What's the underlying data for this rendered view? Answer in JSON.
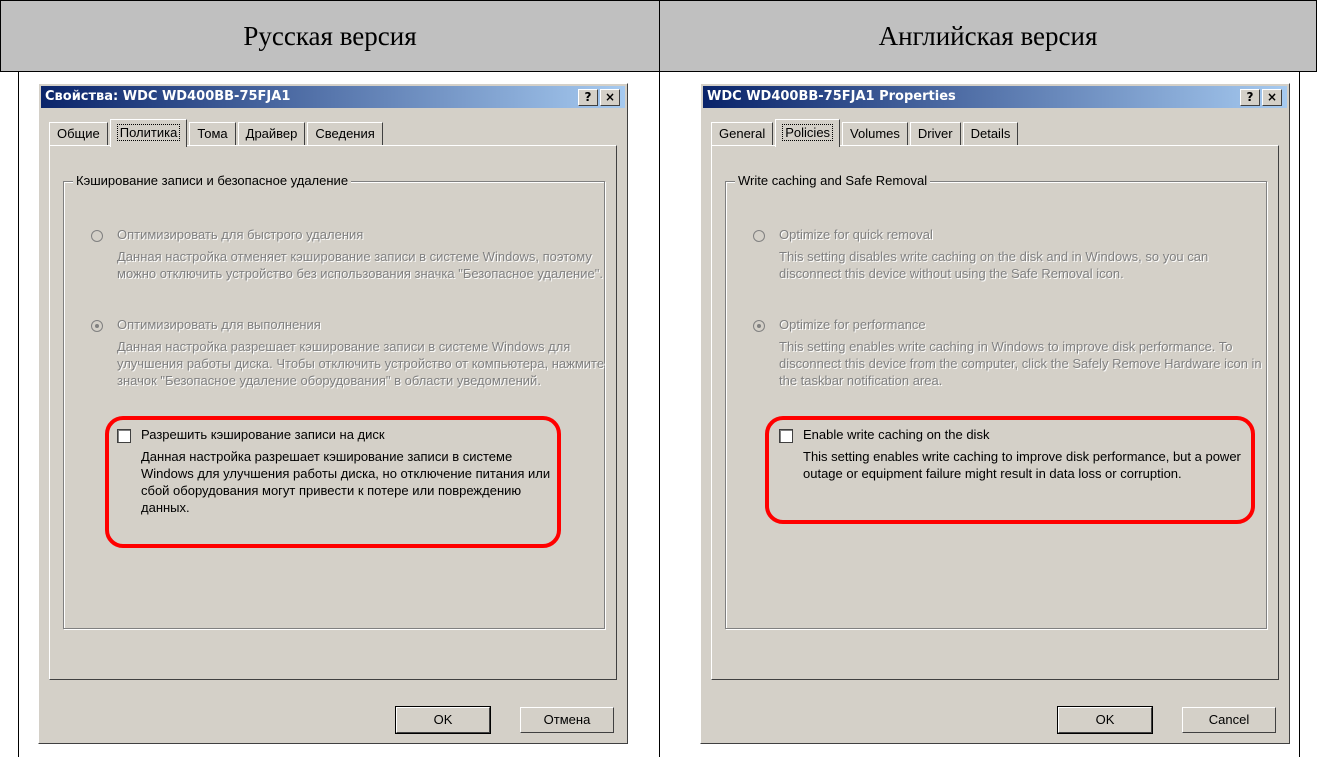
{
  "headers": {
    "left": "Русская версия",
    "right": "Английская версия"
  },
  "ru": {
    "title": "Свойства: WDC WD400BB-75FJA1",
    "help": "?",
    "close": "×",
    "tabs": [
      "Общие",
      "Политика",
      "Тома",
      "Драйвер",
      "Сведения"
    ],
    "group": "Кэширование записи и безопасное удаление",
    "opt1_label": "Оптимизировать для быстрого удаления",
    "opt1_desc": "Данная настройка отменяет кэширование записи в системе Windows, поэтому можно отключить устройство без использования значка \"Безопасное удаление\".",
    "opt2_label": "Оптимизировать для выполнения",
    "opt2_desc": "Данная настройка разрешает кэширование записи в системе Windows для улучшения работы диска. Чтобы отключить устройство от компьютера, нажмите значок \"Безопасное удаление оборудования\" в области уведомлений.",
    "check_label": "Разрешить кэширование записи на диск",
    "check_desc": "Данная настройка разрешает кэширование записи в системе Windows для улучшения работы диска, но отключение питания или сбой оборудования могут привести к потере или повреждению данных.",
    "ok": "OK",
    "cancel": "Отмена"
  },
  "en": {
    "title": "WDC WD400BB-75FJA1 Properties",
    "help": "?",
    "close": "×",
    "tabs": [
      "General",
      "Policies",
      "Volumes",
      "Driver",
      "Details"
    ],
    "group": "Write caching and Safe Removal",
    "opt1_label": "Optimize for quick removal",
    "opt1_desc": "This setting disables write caching on the disk and in Windows, so you can disconnect this device without using the Safe Removal icon.",
    "opt2_label": "Optimize for performance",
    "opt2_desc": "This setting enables write caching in Windows to improve disk performance. To disconnect this device from the computer, click the Safely Remove Hardware icon in the taskbar notification area.",
    "check_label": "Enable write caching on the disk",
    "check_desc": "This setting enables write caching to improve disk performance, but a power outage or equipment failure might result in data loss or corruption.",
    "ok": "OK",
    "cancel": "Cancel"
  },
  "state": {
    "opt1_selected": false,
    "opt2_selected": true,
    "write_cache_checked": false
  },
  "colors": {
    "highlight": "#ff0000",
    "title_start": "#0a246a",
    "title_end": "#a6caf0",
    "dialog_bg": "#d4d0c8"
  }
}
